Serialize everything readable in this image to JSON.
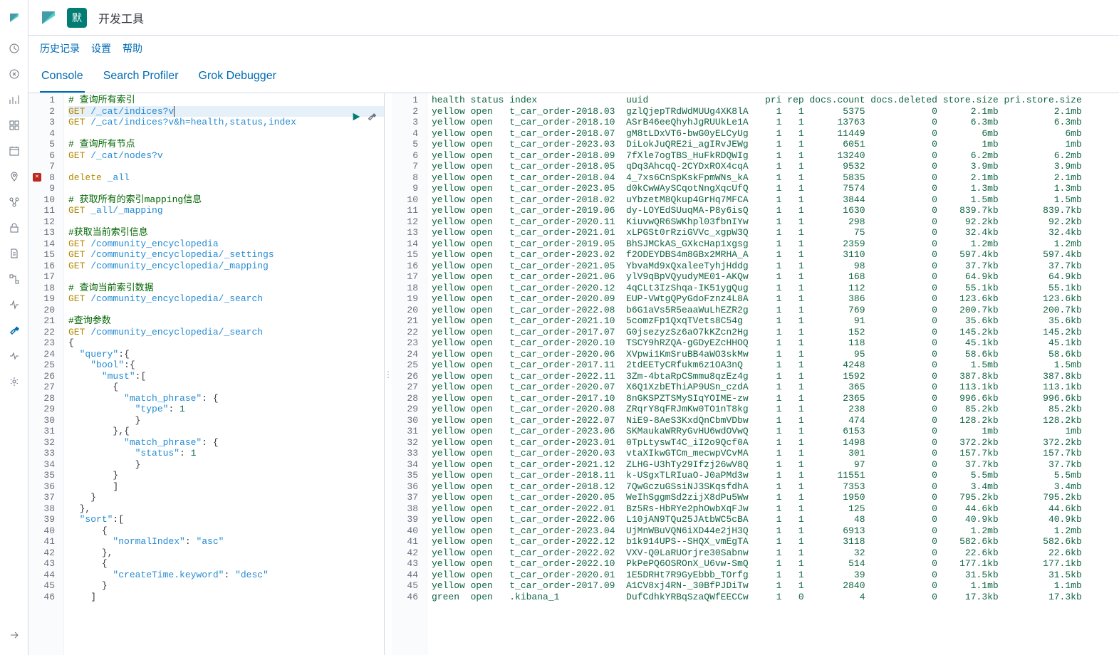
{
  "header": {
    "badge": "默",
    "title": "开发工具"
  },
  "subheader": {
    "history": "历史记录",
    "settings": "设置",
    "help": "帮助"
  },
  "tabs": {
    "console": "Console",
    "profiler": "Search Profiler",
    "grok": "Grok Debugger"
  },
  "editor": {
    "lines": [
      {
        "n": 1,
        "type": "comment",
        "text": "# 查询所有索引"
      },
      {
        "n": 2,
        "type": "req",
        "method": "GET",
        "path": "/_cat/indices?v",
        "active": true
      },
      {
        "n": 3,
        "type": "req",
        "method": "GET",
        "path": "/_cat/indices?v&h=health,status,index"
      },
      {
        "n": 4,
        "type": "blank"
      },
      {
        "n": 5,
        "type": "comment",
        "text": "# 查询所有节点"
      },
      {
        "n": 6,
        "type": "req",
        "method": "GET",
        "path": "/_cat/nodes?v"
      },
      {
        "n": 7,
        "type": "blank"
      },
      {
        "n": 8,
        "type": "err",
        "method": "delete",
        "path": "_all"
      },
      {
        "n": 9,
        "type": "blank"
      },
      {
        "n": 10,
        "type": "comment",
        "text": "# 获取所有的索引mapping信息"
      },
      {
        "n": 11,
        "type": "req",
        "method": "GET",
        "path": "_all/_mapping"
      },
      {
        "n": 12,
        "type": "blank"
      },
      {
        "n": 13,
        "type": "comment",
        "text": "#获取当前索引信息"
      },
      {
        "n": 14,
        "type": "req",
        "method": "GET",
        "path": "/community_encyclopedia"
      },
      {
        "n": 15,
        "type": "req",
        "method": "GET",
        "path": "/community_encyclopedia/_settings"
      },
      {
        "n": 16,
        "type": "req",
        "method": "GET",
        "path": "/community_encyclopedia/_mapping"
      },
      {
        "n": 17,
        "type": "blank"
      },
      {
        "n": 18,
        "type": "comment",
        "text": "# 查询当前索引数据"
      },
      {
        "n": 19,
        "type": "req",
        "method": "GET",
        "path": "/community_encyclopedia/_search"
      },
      {
        "n": 20,
        "type": "blank"
      },
      {
        "n": 21,
        "type": "comment",
        "text": "#查询参数"
      },
      {
        "n": 22,
        "type": "req",
        "method": "GET",
        "path": "/community_encyclopedia/_search"
      },
      {
        "n": 23,
        "type": "json",
        "text": "{",
        "fold": true
      },
      {
        "n": 24,
        "type": "json",
        "text": "  \"query\":{",
        "fold": true
      },
      {
        "n": 25,
        "type": "json",
        "text": "    \"bool\":{",
        "fold": true
      },
      {
        "n": 26,
        "type": "json",
        "text": "      \"must\":[",
        "fold": true
      },
      {
        "n": 27,
        "type": "json",
        "text": "        {",
        "fold": true
      },
      {
        "n": 28,
        "type": "json",
        "text": "          \"match_phrase\": {",
        "fold": true
      },
      {
        "n": 29,
        "type": "json",
        "text": "            \"type\":1"
      },
      {
        "n": 30,
        "type": "json",
        "text": "            }"
      },
      {
        "n": 31,
        "type": "json",
        "text": "        },{",
        "fold": true
      },
      {
        "n": 32,
        "type": "json",
        "text": "          \"match_phrase\": {",
        "fold": true
      },
      {
        "n": 33,
        "type": "json",
        "text": "            \"status\":1"
      },
      {
        "n": 34,
        "type": "json",
        "text": "            }"
      },
      {
        "n": 35,
        "type": "json",
        "text": "        }"
      },
      {
        "n": 36,
        "type": "json",
        "text": "        ]"
      },
      {
        "n": 37,
        "type": "json",
        "text": "    }"
      },
      {
        "n": 38,
        "type": "json",
        "text": "  },"
      },
      {
        "n": 39,
        "type": "json",
        "text": "  \"sort\":[",
        "fold": true
      },
      {
        "n": 40,
        "type": "json",
        "text": "      {",
        "fold": true
      },
      {
        "n": 41,
        "type": "json",
        "text": "        \"normalIndex\":\"asc\""
      },
      {
        "n": 42,
        "type": "json",
        "text": "      },"
      },
      {
        "n": 43,
        "type": "json",
        "text": "      {",
        "fold": true
      },
      {
        "n": 44,
        "type": "json",
        "text": "        \"createTime.keyword\":\"desc\""
      },
      {
        "n": 45,
        "type": "json",
        "text": "      }"
      },
      {
        "n": 46,
        "type": "json",
        "text": "    ]",
        "fold": true
      }
    ]
  },
  "output": {
    "header": {
      "health": "health",
      "status": "status",
      "index": "index",
      "uuid": "uuid",
      "pri": "pri",
      "rep": "rep",
      "docs_count": "docs.count",
      "docs_deleted": "docs.deleted",
      "store_size": "store.size",
      "pri_store_size": "pri.store.size"
    },
    "rows": [
      {
        "n": 2,
        "health": "yellow",
        "status": "open",
        "index": "t_car_order-2018.03",
        "uuid": "gzlQjepTRdWdMUUg4XK8lA",
        "pri": 1,
        "rep": 1,
        "docs_count": 5375,
        "docs_deleted": 0,
        "store_size": "2.1mb",
        "pri_store_size": "2.1mb"
      },
      {
        "n": 3,
        "health": "yellow",
        "status": "open",
        "index": "t_car_order-2018.10",
        "uuid": "ASrB46eeQhyhJgRUUkLe1A",
        "pri": 1,
        "rep": 1,
        "docs_count": 13763,
        "docs_deleted": 0,
        "store_size": "6.3mb",
        "pri_store_size": "6.3mb"
      },
      {
        "n": 4,
        "health": "yellow",
        "status": "open",
        "index": "t_car_order-2018.07",
        "uuid": "gM8tLDxVT6-bwG0yELCyUg",
        "pri": 1,
        "rep": 1,
        "docs_count": 11449,
        "docs_deleted": 0,
        "store_size": "6mb",
        "pri_store_size": "6mb"
      },
      {
        "n": 5,
        "health": "yellow",
        "status": "open",
        "index": "t_car_order-2023.03",
        "uuid": "DiLokJuQRE2i_agIRvJEWg",
        "pri": 1,
        "rep": 1,
        "docs_count": 6051,
        "docs_deleted": 0,
        "store_size": "1mb",
        "pri_store_size": "1mb"
      },
      {
        "n": 6,
        "health": "yellow",
        "status": "open",
        "index": "t_car_order-2018.09",
        "uuid": "7fXle7ogTBS_HuFkRDQWIg",
        "pri": 1,
        "rep": 1,
        "docs_count": 13240,
        "docs_deleted": 0,
        "store_size": "6.2mb",
        "pri_store_size": "6.2mb"
      },
      {
        "n": 7,
        "health": "yellow",
        "status": "open",
        "index": "t_car_order-2018.05",
        "uuid": "qDq3AhcqQ-2CYDxROX4cqA",
        "pri": 1,
        "rep": 1,
        "docs_count": 9532,
        "docs_deleted": 0,
        "store_size": "3.9mb",
        "pri_store_size": "3.9mb"
      },
      {
        "n": 8,
        "health": "yellow",
        "status": "open",
        "index": "t_car_order-2018.04",
        "uuid": "4_7xs6CnSpKskFpmWNs_kA",
        "pri": 1,
        "rep": 1,
        "docs_count": 5835,
        "docs_deleted": 0,
        "store_size": "2.1mb",
        "pri_store_size": "2.1mb"
      },
      {
        "n": 9,
        "health": "yellow",
        "status": "open",
        "index": "t_car_order-2023.05",
        "uuid": "d0kCwWAySCqotNngXqcUfQ",
        "pri": 1,
        "rep": 1,
        "docs_count": 7574,
        "docs_deleted": 0,
        "store_size": "1.3mb",
        "pri_store_size": "1.3mb"
      },
      {
        "n": 10,
        "health": "yellow",
        "status": "open",
        "index": "t_car_order-2018.02",
        "uuid": "uYbzetM8Qkup4GrHq7MFCA",
        "pri": 1,
        "rep": 1,
        "docs_count": 3844,
        "docs_deleted": 0,
        "store_size": "1.5mb",
        "pri_store_size": "1.5mb"
      },
      {
        "n": 11,
        "health": "yellow",
        "status": "open",
        "index": "t_car_order-2019.06",
        "uuid": "dy-LOYEdSUuqMA-P8y6isQ",
        "pri": 1,
        "rep": 1,
        "docs_count": 1630,
        "docs_deleted": 0,
        "store_size": "839.7kb",
        "pri_store_size": "839.7kb"
      },
      {
        "n": 12,
        "health": "yellow",
        "status": "open",
        "index": "t_car_order-2020.11",
        "uuid": "KiuvwQR6SWKhpl03fbnIYw",
        "pri": 1,
        "rep": 1,
        "docs_count": 298,
        "docs_deleted": 0,
        "store_size": "92.2kb",
        "pri_store_size": "92.2kb"
      },
      {
        "n": 13,
        "health": "yellow",
        "status": "open",
        "index": "t_car_order-2021.01",
        "uuid": "xLPGSt0rRziGVVc_xgpW3Q",
        "pri": 1,
        "rep": 1,
        "docs_count": 75,
        "docs_deleted": 0,
        "store_size": "32.4kb",
        "pri_store_size": "32.4kb"
      },
      {
        "n": 14,
        "health": "yellow",
        "status": "open",
        "index": "t_car_order-2019.05",
        "uuid": "BhSJMCkAS_GXkcHap1xgsg",
        "pri": 1,
        "rep": 1,
        "docs_count": 2359,
        "docs_deleted": 0,
        "store_size": "1.2mb",
        "pri_store_size": "1.2mb"
      },
      {
        "n": 15,
        "health": "yellow",
        "status": "open",
        "index": "t_car_order-2023.02",
        "uuid": "f2ODEYDBS4m8GBx2MRHA_A",
        "pri": 1,
        "rep": 1,
        "docs_count": 3110,
        "docs_deleted": 0,
        "store_size": "597.4kb",
        "pri_store_size": "597.4kb"
      },
      {
        "n": 16,
        "health": "yellow",
        "status": "open",
        "index": "t_car_order-2021.05",
        "uuid": "YbvaMd9xQxaleeTyhjHddg",
        "pri": 1,
        "rep": 1,
        "docs_count": 98,
        "docs_deleted": 0,
        "store_size": "37.7kb",
        "pri_store_size": "37.7kb"
      },
      {
        "n": 17,
        "health": "yellow",
        "status": "open",
        "index": "t_car_order-2021.06",
        "uuid": "ylV9qBpVQyudyME01-AKQw",
        "pri": 1,
        "rep": 1,
        "docs_count": 168,
        "docs_deleted": 0,
        "store_size": "64.9kb",
        "pri_store_size": "64.9kb"
      },
      {
        "n": 18,
        "health": "yellow",
        "status": "open",
        "index": "t_car_order-2020.12",
        "uuid": "4qCLt3IzShqa-IK51ygQug",
        "pri": 1,
        "rep": 1,
        "docs_count": 112,
        "docs_deleted": 0,
        "store_size": "55.1kb",
        "pri_store_size": "55.1kb"
      },
      {
        "n": 19,
        "health": "yellow",
        "status": "open",
        "index": "t_car_order-2020.09",
        "uuid": "EUP-VWtgQPyGdoFznz4L8A",
        "pri": 1,
        "rep": 1,
        "docs_count": 386,
        "docs_deleted": 0,
        "store_size": "123.6kb",
        "pri_store_size": "123.6kb"
      },
      {
        "n": 20,
        "health": "yellow",
        "status": "open",
        "index": "t_car_order-2022.08",
        "uuid": "b6G1aVs5R5eaaWuLhEZR2g",
        "pri": 1,
        "rep": 1,
        "docs_count": 769,
        "docs_deleted": 0,
        "store_size": "200.7kb",
        "pri_store_size": "200.7kb"
      },
      {
        "n": 21,
        "health": "yellow",
        "status": "open",
        "index": "t_car_order-2021.10",
        "uuid": "5comzFp1QxqTVets8C54g",
        "pri": 1,
        "rep": 1,
        "docs_count": 91,
        "docs_deleted": 0,
        "store_size": "35.6kb",
        "pri_store_size": "35.6kb"
      },
      {
        "n": 22,
        "health": "yellow",
        "status": "open",
        "index": "t_car_order-2017.07",
        "uuid": "G0jsezyzSz6aO7kKZcn2Hg",
        "pri": 1,
        "rep": 1,
        "docs_count": 152,
        "docs_deleted": 0,
        "store_size": "145.2kb",
        "pri_store_size": "145.2kb"
      },
      {
        "n": 23,
        "health": "yellow",
        "status": "open",
        "index": "t_car_order-2020.10",
        "uuid": "TSCY9hRZQA-gGDyEZcHHOQ",
        "pri": 1,
        "rep": 1,
        "docs_count": 118,
        "docs_deleted": 0,
        "store_size": "45.1kb",
        "pri_store_size": "45.1kb"
      },
      {
        "n": 24,
        "health": "yellow",
        "status": "open",
        "index": "t_car_order-2020.06",
        "uuid": "XVpwi1KmSruBB4aWO3skMw",
        "pri": 1,
        "rep": 1,
        "docs_count": 95,
        "docs_deleted": 0,
        "store_size": "58.6kb",
        "pri_store_size": "58.6kb"
      },
      {
        "n": 25,
        "health": "yellow",
        "status": "open",
        "index": "t_car_order-2017.11",
        "uuid": "2tdEETyCRfukm6z1OA3nQ",
        "pri": 1,
        "rep": 1,
        "docs_count": 4248,
        "docs_deleted": 0,
        "store_size": "1.5mb",
        "pri_store_size": "1.5mb"
      },
      {
        "n": 26,
        "health": "yellow",
        "status": "open",
        "index": "t_car_order-2022.11",
        "uuid": "3Zm-4btaRpCSmmu8qzEz4g",
        "pri": 1,
        "rep": 1,
        "docs_count": 1592,
        "docs_deleted": 0,
        "store_size": "387.8kb",
        "pri_store_size": "387.8kb"
      },
      {
        "n": 27,
        "health": "yellow",
        "status": "open",
        "index": "t_car_order-2020.07",
        "uuid": "X6Q1XzbEThiAP9USn_czdA",
        "pri": 1,
        "rep": 1,
        "docs_count": 365,
        "docs_deleted": 0,
        "store_size": "113.1kb",
        "pri_store_size": "113.1kb"
      },
      {
        "n": 28,
        "health": "yellow",
        "status": "open",
        "index": "t_car_order-2017.10",
        "uuid": "8nGKSPZTSMySIqYOIME-zw",
        "pri": 1,
        "rep": 1,
        "docs_count": 2365,
        "docs_deleted": 0,
        "store_size": "996.6kb",
        "pri_store_size": "996.6kb"
      },
      {
        "n": 29,
        "health": "yellow",
        "status": "open",
        "index": "t_car_order-2020.08",
        "uuid": "ZRqrY8qFRJmKw0TO1nT8kg",
        "pri": 1,
        "rep": 1,
        "docs_count": 238,
        "docs_deleted": 0,
        "store_size": "85.2kb",
        "pri_store_size": "85.2kb"
      },
      {
        "n": 30,
        "health": "yellow",
        "status": "open",
        "index": "t_car_order-2022.07",
        "uuid": "NiE9-8AeS3KxdQnCbmVDbw",
        "pri": 1,
        "rep": 1,
        "docs_count": 474,
        "docs_deleted": 0,
        "store_size": "128.2kb",
        "pri_store_size": "128.2kb"
      },
      {
        "n": 31,
        "health": "yellow",
        "status": "open",
        "index": "t_car_order-2023.06",
        "uuid": "SKMaukaWRRyGvHU6wdOVwQ",
        "pri": 1,
        "rep": 1,
        "docs_count": 6153,
        "docs_deleted": 0,
        "store_size": "1mb",
        "pri_store_size": "1mb"
      },
      {
        "n": 32,
        "health": "yellow",
        "status": "open",
        "index": "t_car_order-2023.01",
        "uuid": "0TpLtyswT4C_iI2o9Qcf0A",
        "pri": 1,
        "rep": 1,
        "docs_count": 1498,
        "docs_deleted": 0,
        "store_size": "372.2kb",
        "pri_store_size": "372.2kb"
      },
      {
        "n": 33,
        "health": "yellow",
        "status": "open",
        "index": "t_car_order-2020.03",
        "uuid": "vtaXIkwGTCm_mecwpVCvMA",
        "pri": 1,
        "rep": 1,
        "docs_count": 301,
        "docs_deleted": 0,
        "store_size": "157.7kb",
        "pri_store_size": "157.7kb"
      },
      {
        "n": 34,
        "health": "yellow",
        "status": "open",
        "index": "t_car_order-2021.12",
        "uuid": "ZLHG-U3hTy29Ifzj26wV8Q",
        "pri": 1,
        "rep": 1,
        "docs_count": 97,
        "docs_deleted": 0,
        "store_size": "37.7kb",
        "pri_store_size": "37.7kb"
      },
      {
        "n": 35,
        "health": "yellow",
        "status": "open",
        "index": "t_car_order-2018.11",
        "uuid": "k-USgxTLRIuaO-J0aPMd3w",
        "pri": 1,
        "rep": 1,
        "docs_count": 11551,
        "docs_deleted": 0,
        "store_size": "5.5mb",
        "pri_store_size": "5.5mb"
      },
      {
        "n": 36,
        "health": "yellow",
        "status": "open",
        "index": "t_car_order-2018.12",
        "uuid": "7QwGczuGSsiNJ3SKqsfdhA",
        "pri": 1,
        "rep": 1,
        "docs_count": 7353,
        "docs_deleted": 0,
        "store_size": "3.4mb",
        "pri_store_size": "3.4mb"
      },
      {
        "n": 37,
        "health": "yellow",
        "status": "open",
        "index": "t_car_order-2020.05",
        "uuid": "WeIhSggmSd2zijX8dPu5Ww",
        "pri": 1,
        "rep": 1,
        "docs_count": 1950,
        "docs_deleted": 0,
        "store_size": "795.2kb",
        "pri_store_size": "795.2kb"
      },
      {
        "n": 38,
        "health": "yellow",
        "status": "open",
        "index": "t_car_order-2022.01",
        "uuid": "Bz5Rs-HbRYe2phOwbXqFJw",
        "pri": 1,
        "rep": 1,
        "docs_count": 125,
        "docs_deleted": 0,
        "store_size": "44.6kb",
        "pri_store_size": "44.6kb"
      },
      {
        "n": 39,
        "health": "yellow",
        "status": "open",
        "index": "t_car_order-2022.06",
        "uuid": "L10jAN9TQu25JAtbWC5cBA",
        "pri": 1,
        "rep": 1,
        "docs_count": 48,
        "docs_deleted": 0,
        "store_size": "40.9kb",
        "pri_store_size": "40.9kb"
      },
      {
        "n": 40,
        "health": "yellow",
        "status": "open",
        "index": "t_car_order-2023.04",
        "uuid": "UjMnWBuVQN6iXD44e2jH3Q",
        "pri": 1,
        "rep": 1,
        "docs_count": 6913,
        "docs_deleted": 0,
        "store_size": "1.2mb",
        "pri_store_size": "1.2mb"
      },
      {
        "n": 41,
        "health": "yellow",
        "status": "open",
        "index": "t_car_order-2022.12",
        "uuid": "b1k914UPS--SHQX_vmEgTA",
        "pri": 1,
        "rep": 1,
        "docs_count": 3118,
        "docs_deleted": 0,
        "store_size": "582.6kb",
        "pri_store_size": "582.6kb"
      },
      {
        "n": 42,
        "health": "yellow",
        "status": "open",
        "index": "t_car_order-2022.02",
        "uuid": "VXV-Q0LaRUOrjre30Sabnw",
        "pri": 1,
        "rep": 1,
        "docs_count": 32,
        "docs_deleted": 0,
        "store_size": "22.6kb",
        "pri_store_size": "22.6kb"
      },
      {
        "n": 43,
        "health": "yellow",
        "status": "open",
        "index": "t_car_order-2022.10",
        "uuid": "PkPePQ6OSROnX_U6vw-SmQ",
        "pri": 1,
        "rep": 1,
        "docs_count": 514,
        "docs_deleted": 0,
        "store_size": "177.1kb",
        "pri_store_size": "177.1kb"
      },
      {
        "n": 44,
        "health": "yellow",
        "status": "open",
        "index": "t_car_order-2020.01",
        "uuid": "1E5DRHt7R9GyEbbb_TOrfg",
        "pri": 1,
        "rep": 1,
        "docs_count": 39,
        "docs_deleted": 0,
        "store_size": "31.5kb",
        "pri_store_size": "31.5kb"
      },
      {
        "n": 45,
        "health": "yellow",
        "status": "open",
        "index": "t_car_order-2017.09",
        "uuid": "A1CV8xj4RN-_30BfPJDiTw",
        "pri": 1,
        "rep": 1,
        "docs_count": 2840,
        "docs_deleted": 0,
        "store_size": "1.1mb",
        "pri_store_size": "1.1mb"
      },
      {
        "n": 46,
        "health": "green",
        "status": "open",
        "index": ".kibana_1",
        "uuid": "DufCdhkYRBqSzaQWfEECCw",
        "pri": 1,
        "rep": 0,
        "docs_count": 4,
        "docs_deleted": 0,
        "store_size": "17.3kb",
        "pri_store_size": "17.3kb"
      }
    ]
  }
}
